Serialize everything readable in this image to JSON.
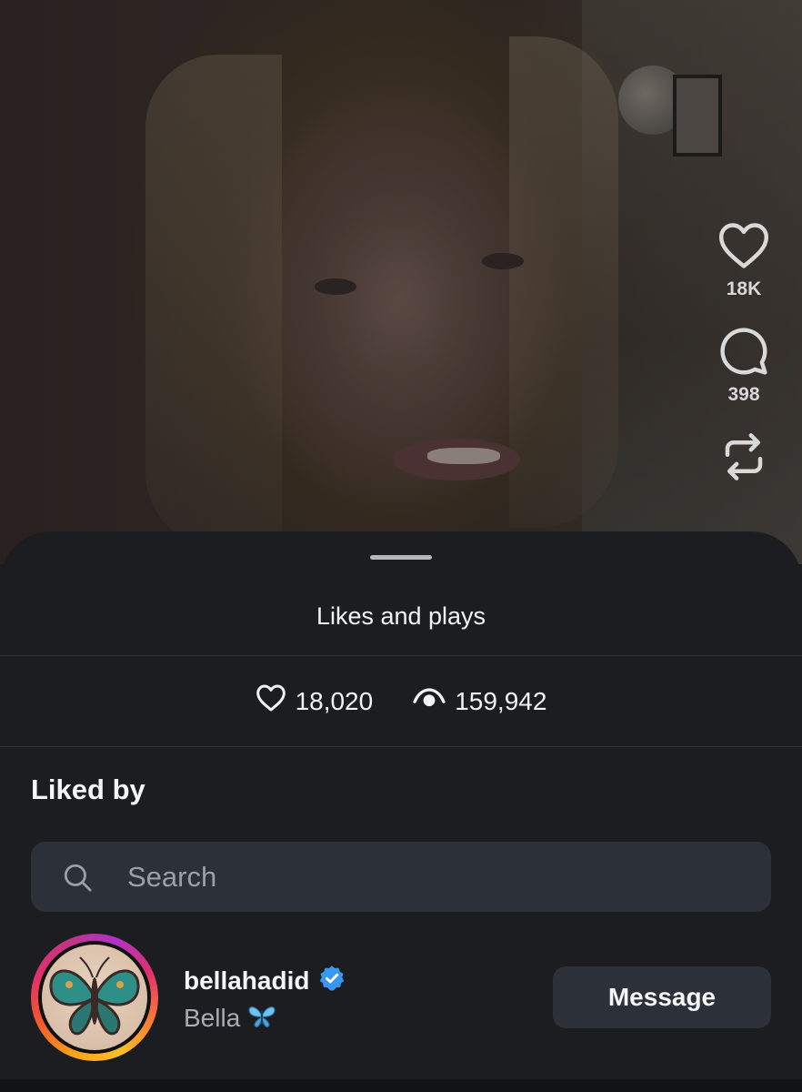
{
  "video": {
    "description_icon": "video-frame"
  },
  "action_rail": {
    "likes": {
      "icon": "heart-icon",
      "count": "18K"
    },
    "comments": {
      "icon": "comment-icon",
      "count": "398"
    },
    "repost": {
      "icon": "repost-icon"
    }
  },
  "sheet": {
    "title": "Likes and plays",
    "stats": {
      "likes": {
        "icon": "heart-outline-icon",
        "value": "18,020"
      },
      "plays": {
        "icon": "eye-icon",
        "value": "159,942"
      }
    },
    "liked_by_title": "Liked by",
    "search": {
      "placeholder": "Search",
      "value": ""
    },
    "users": [
      {
        "username": "bellahadid",
        "verified": true,
        "full_name": "Bella",
        "name_emoji": "butterfly-icon",
        "action_label": "Message"
      }
    ]
  },
  "colors": {
    "sheet_bg": "#1c1d21",
    "search_bg": "#2c3038",
    "verified_badge": "#3897f0",
    "muted_text": "#a7acb4"
  }
}
